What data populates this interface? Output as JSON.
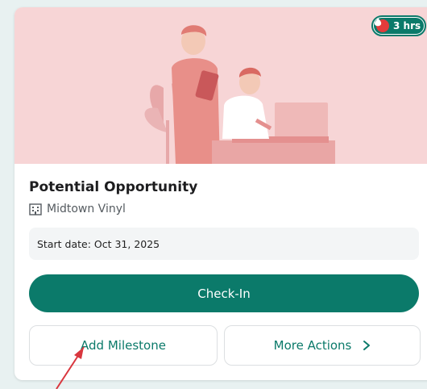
{
  "card": {
    "badge": {
      "text": "3 hrs",
      "icon": "flame-icon",
      "color": "#0b7a6a"
    },
    "title": "Potential Opportunity",
    "company": {
      "icon": "building-icon",
      "name": "Midtown Vinyl"
    },
    "start_date_label": "Start date: Oct 31, 2025",
    "checkin_label": "Check-In",
    "add_milestone_label": "Add Milestone",
    "more_actions_label": "More Actions",
    "more_actions_icon": "chevron-right-icon"
  },
  "colors": {
    "accent": "#0b7a6a",
    "hero_bg": "#f7d5d6",
    "annotation_arrow": "#d9363e"
  }
}
